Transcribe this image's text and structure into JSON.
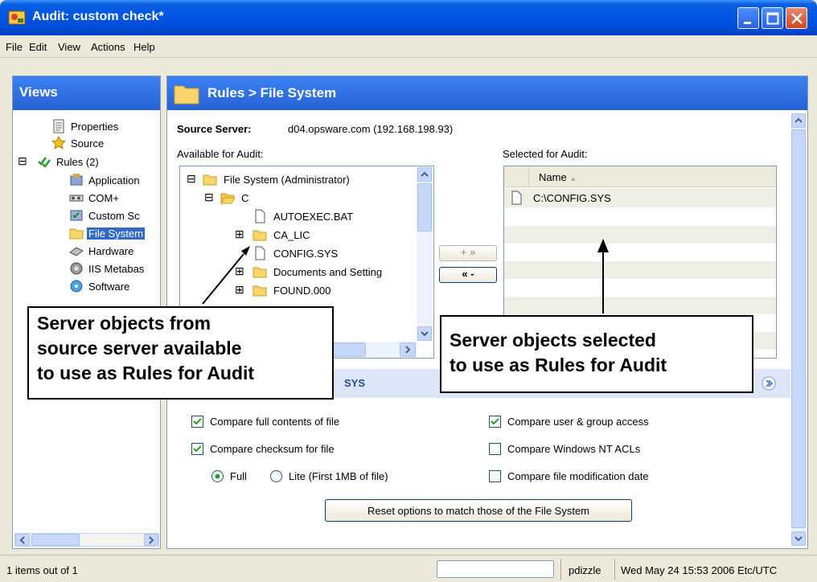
{
  "window": {
    "title": "Audit: custom check*"
  },
  "menu": [
    "File",
    "Edit",
    "View",
    "Actions",
    "Help"
  ],
  "views": {
    "header": "Views",
    "items": [
      {
        "label": "Properties",
        "icon": "document-icon"
      },
      {
        "label": "Source",
        "icon": "star-icon"
      },
      {
        "label": "Rules (2)",
        "icon": "rules-check-icon",
        "expander": "⊟"
      },
      {
        "label": "Application",
        "icon": "application-icon"
      },
      {
        "label": "COM+",
        "icon": "com-icon"
      },
      {
        "label": "Custom Sc",
        "icon": "custom-script-icon"
      },
      {
        "label": "File System",
        "icon": "folder-icon",
        "selected": true
      },
      {
        "label": "Hardware",
        "icon": "hardware-icon"
      },
      {
        "label": "IIS Metabas",
        "icon": "iis-icon"
      },
      {
        "label": "Software",
        "icon": "software-icon"
      }
    ]
  },
  "main": {
    "header": "Rules > File System",
    "source_label": "Source Server:",
    "source_value": "d04.opsware.com  (192.168.198.93)",
    "available_label": "Available for Audit:",
    "selected_label": "Selected for Audit:",
    "available_tree": [
      {
        "label": "File System (Administrator)",
        "icon": "folder-icon",
        "expander": "⊟"
      },
      {
        "label": "C",
        "icon": "open-folder-icon",
        "expander": "⊟"
      },
      {
        "label": "AUTOEXEC.BAT",
        "icon": "file-icon"
      },
      {
        "label": "CA_LIC",
        "icon": "folder-icon",
        "expander": "⊞"
      },
      {
        "label": "CONFIG.SYS",
        "icon": "file-icon"
      },
      {
        "label": "Documents and Setting",
        "icon": "folder-icon",
        "expander": "⊞"
      },
      {
        "label": "FOUND.000",
        "icon": "folder-icon",
        "expander": "⊞"
      }
    ],
    "add_button": "+ »",
    "remove_button": "« -",
    "selected_table": {
      "column": "Name",
      "sort_indicator": "▲",
      "rows": [
        "C:\\CONFIG.SYS"
      ]
    },
    "section_title_partial": "SYS",
    "options": {
      "compare_full_contents": {
        "label": "Compare full contents of file",
        "checked": true
      },
      "compare_checksum": {
        "label": "Compare checksum for file",
        "checked": true
      },
      "full": {
        "label": "Full",
        "selected": true
      },
      "lite": {
        "label": "Lite (First 1MB of file)",
        "selected": false
      },
      "compare_user_group": {
        "label": "Compare user & group access",
        "checked": true
      },
      "compare_nt_acls": {
        "label": "Compare Windows NT ACLs",
        "checked": false
      },
      "compare_mod_date": {
        "label": "Compare file modification date",
        "checked": false
      }
    },
    "reset_button": "Reset options to match those of the File System"
  },
  "callouts": {
    "left": [
      "Server objects from",
      "source server available",
      "to use as Rules for Audit"
    ],
    "right": [
      "Server objects selected",
      "to use as Rules for Audit"
    ]
  },
  "status": {
    "left": "1 items out of 1",
    "user": "pdizzle",
    "datetime": "Wed May 24 15:53 2006 Etc/UTC"
  }
}
